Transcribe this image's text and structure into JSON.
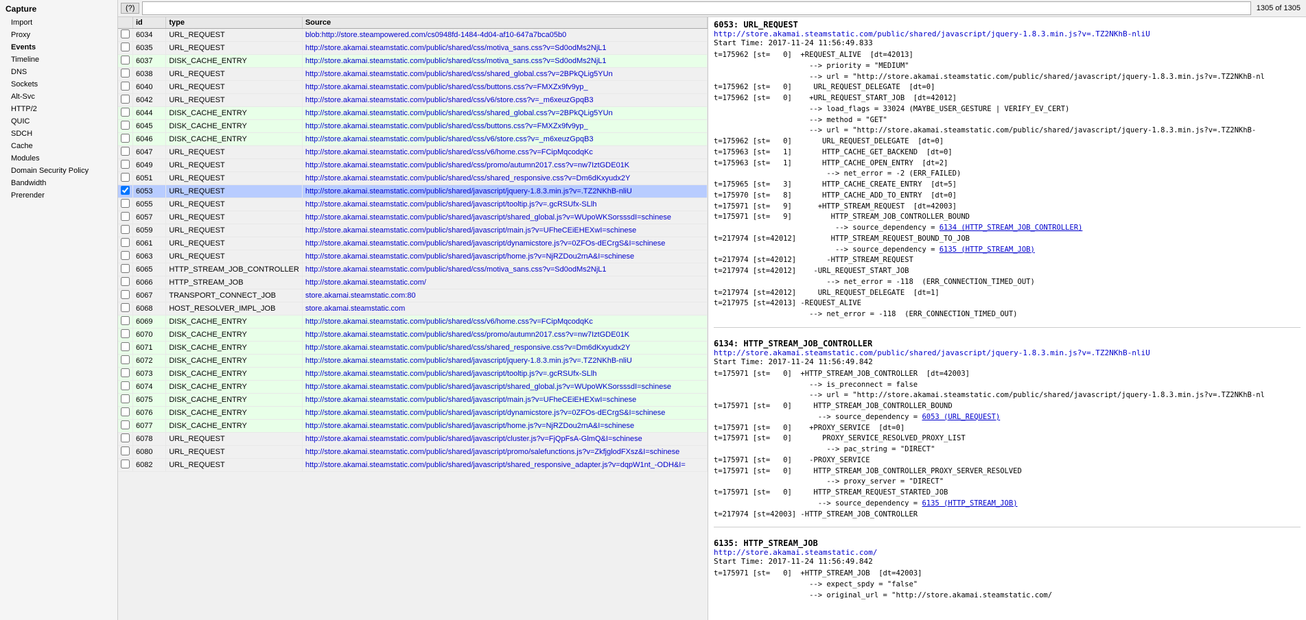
{
  "sidebar": {
    "capture_label": "Capture",
    "items": [
      {
        "id": "import",
        "label": "Import",
        "active": false
      },
      {
        "id": "proxy",
        "label": "Proxy",
        "active": false
      },
      {
        "id": "events",
        "label": "Events",
        "active": false,
        "bold": true
      },
      {
        "id": "timeline",
        "label": "Timeline",
        "active": false
      },
      {
        "id": "dns",
        "label": "DNS",
        "active": false
      },
      {
        "id": "sockets",
        "label": "Sockets",
        "active": false
      },
      {
        "id": "alt-svc",
        "label": "Alt-Svc",
        "active": false
      },
      {
        "id": "http2",
        "label": "HTTP/2",
        "active": false
      },
      {
        "id": "quic",
        "label": "QUIC",
        "active": false
      },
      {
        "id": "sdch",
        "label": "SDCH",
        "active": false
      },
      {
        "id": "cache",
        "label": "Cache",
        "active": false
      },
      {
        "id": "modules",
        "label": "Modules",
        "active": false
      },
      {
        "id": "domain-security-policy",
        "label": "Domain Security Policy",
        "active": false
      },
      {
        "id": "bandwidth",
        "label": "Bandwidth",
        "active": false
      },
      {
        "id": "prerender",
        "label": "Prerender",
        "active": false
      }
    ]
  },
  "toolbar": {
    "help_label": "(?)",
    "search_placeholder": "",
    "count_label": "1305 of 1305"
  },
  "table": {
    "columns": [
      "",
      "id",
      "type",
      "source"
    ],
    "source_header": "Source",
    "rows": [
      {
        "id": "6034",
        "type": "URL_REQUEST",
        "source": "blob:http://store.steampowered.com/cs0948fd-1484-4d04-af10-647a7bca05b0",
        "checked": false,
        "rowtype": "normal",
        "selected": false
      },
      {
        "id": "6035",
        "type": "URL_REQUEST",
        "source": "http://store.akamai.steamstatic.com/public/shared/css/motiva_sans.css?v=Sd0odMs2NjL1",
        "checked": false,
        "rowtype": "normal",
        "selected": false
      },
      {
        "id": "6037",
        "type": "DISK_CACHE_ENTRY",
        "source": "http://store.akamai.steamstatic.com/public/shared/css/motiva_sans.css?v=Sd0odMs2NjL1",
        "checked": false,
        "rowtype": "disk-cache",
        "selected": false
      },
      {
        "id": "6038",
        "type": "URL_REQUEST",
        "source": "http://store.akamai.steamstatic.com/public/shared/css/shared_global.css?v=2BPkQLig5YUn",
        "checked": false,
        "rowtype": "normal",
        "selected": false
      },
      {
        "id": "6040",
        "type": "URL_REQUEST",
        "source": "http://store.akamai.steamstatic.com/public/shared/css/buttons.css?v=FMXZx9fv9yp_",
        "checked": false,
        "rowtype": "normal",
        "selected": false
      },
      {
        "id": "6042",
        "type": "URL_REQUEST",
        "source": "http://store.akamai.steamstatic.com/public/shared/css/v6/store.css?v=_m6xeuzGpqB3",
        "checked": false,
        "rowtype": "normal",
        "selected": false
      },
      {
        "id": "6044",
        "type": "DISK_CACHE_ENTRY",
        "source": "http://store.akamai.steamstatic.com/public/shared/css/shared_global.css?v=2BPkQLig5YUn",
        "checked": false,
        "rowtype": "disk-cache",
        "selected": false
      },
      {
        "id": "6045",
        "type": "DISK_CACHE_ENTRY",
        "source": "http://store.akamai.steamstatic.com/public/shared/css/buttons.css?v=FMXZx9fv9yp_",
        "checked": false,
        "rowtype": "disk-cache",
        "selected": false
      },
      {
        "id": "6046",
        "type": "DISK_CACHE_ENTRY",
        "source": "http://store.akamai.steamstatic.com/public/shared/css/v6/store.css?v=_m6xeuzGpqB3",
        "checked": false,
        "rowtype": "disk-cache",
        "selected": false
      },
      {
        "id": "6047",
        "type": "URL_REQUEST",
        "source": "http://store.akamai.steamstatic.com/public/shared/css/v6/home.css?v=FCipMqcodqKc",
        "checked": false,
        "rowtype": "normal",
        "selected": false
      },
      {
        "id": "6049",
        "type": "URL_REQUEST",
        "source": "http://store.akamai.steamstatic.com/public/shared/css/promo/autumn2017.css?v=nw7IztGDE01K",
        "checked": false,
        "rowtype": "normal",
        "selected": false
      },
      {
        "id": "6051",
        "type": "URL_REQUEST",
        "source": "http://store.akamai.steamstatic.com/public/shared/css/shared_responsive.css?v=Dm6dKxyudx2Y",
        "checked": false,
        "rowtype": "normal",
        "selected": false
      },
      {
        "id": "6053",
        "type": "URL_REQUEST",
        "source": "http://store.akamai.steamstatic.com/public/shared/javascript/jquery-1.8.3.min.js?v=.TZ2NKhB-nliU",
        "checked": true,
        "rowtype": "normal",
        "selected": true
      },
      {
        "id": "6055",
        "type": "URL_REQUEST",
        "source": "http://store.akamai.steamstatic.com/public/shared/javascript/tooltip.js?v=.gcRSUfx-SLlh",
        "checked": false,
        "rowtype": "normal",
        "selected": false
      },
      {
        "id": "6057",
        "type": "URL_REQUEST",
        "source": "http://store.akamai.steamstatic.com/public/shared/javascript/shared_global.js?v=WUpoWKSorsssdI=schinese",
        "checked": false,
        "rowtype": "normal",
        "selected": false
      },
      {
        "id": "6059",
        "type": "URL_REQUEST",
        "source": "http://store.akamai.steamstatic.com/public/shared/javascript/main.js?v=UFheCEiEHEXwI=schinese",
        "checked": false,
        "rowtype": "normal",
        "selected": false
      },
      {
        "id": "6061",
        "type": "URL_REQUEST",
        "source": "http://store.akamai.steamstatic.com/public/shared/javascript/dynamicstore.js?v=0ZFOs-dECrgS&I=schinese",
        "checked": false,
        "rowtype": "normal",
        "selected": false
      },
      {
        "id": "6063",
        "type": "URL_REQUEST",
        "source": "http://store.akamai.steamstatic.com/public/shared/javascript/home.js?v=NjRZDou2rnA&I=schinese",
        "checked": false,
        "rowtype": "normal",
        "selected": false
      },
      {
        "id": "6065",
        "type": "HTTP_STREAM_JOB_CONTROLLER",
        "source": "http://store.akamai.steamstatic.com/public/shared/css/motiva_sans.css?v=Sd0odMs2NjL1",
        "checked": false,
        "rowtype": "normal",
        "selected": false
      },
      {
        "id": "6066",
        "type": "HTTP_STREAM_JOB",
        "source": "http://store.akamai.steamstatic.com/",
        "checked": false,
        "rowtype": "normal",
        "selected": false
      },
      {
        "id": "6067",
        "type": "TRANSPORT_CONNECT_JOB",
        "source": "store.akamai.steamstatic.com:80",
        "checked": false,
        "rowtype": "normal",
        "selected": false
      },
      {
        "id": "6068",
        "type": "HOST_RESOLVER_IMPL_JOB",
        "source": "store.akamai.steamstatic.com",
        "checked": false,
        "rowtype": "normal",
        "selected": false
      },
      {
        "id": "6069",
        "type": "DISK_CACHE_ENTRY",
        "source": "http://store.akamai.steamstatic.com/public/shared/css/v6/home.css?v=FCipMqcodqKc",
        "checked": false,
        "rowtype": "disk-cache",
        "selected": false
      },
      {
        "id": "6070",
        "type": "DISK_CACHE_ENTRY",
        "source": "http://store.akamai.steamstatic.com/public/shared/css/promo/autumn2017.css?v=nw7IztGDE01K",
        "checked": false,
        "rowtype": "disk-cache",
        "selected": false
      },
      {
        "id": "6071",
        "type": "DISK_CACHE_ENTRY",
        "source": "http://store.akamai.steamstatic.com/public/shared/css/shared_responsive.css?v=Dm6dKxyudx2Y",
        "checked": false,
        "rowtype": "disk-cache",
        "selected": false
      },
      {
        "id": "6072",
        "type": "DISK_CACHE_ENTRY",
        "source": "http://store.akamai.steamstatic.com/public/shared/javascript/jquery-1.8.3.min.js?v=.TZ2NKhB-nliU",
        "checked": false,
        "rowtype": "disk-cache",
        "selected": false
      },
      {
        "id": "6073",
        "type": "DISK_CACHE_ENTRY",
        "source": "http://store.akamai.steamstatic.com/public/shared/javascript/tooltip.js?v=.gcRSUfx-SLlh",
        "checked": false,
        "rowtype": "disk-cache",
        "selected": false
      },
      {
        "id": "6074",
        "type": "DISK_CACHE_ENTRY",
        "source": "http://store.akamai.steamstatic.com/public/shared/javascript/shared_global.js?v=WUpoWKSorsssdI=schinese",
        "checked": false,
        "rowtype": "disk-cache",
        "selected": false
      },
      {
        "id": "6075",
        "type": "DISK_CACHE_ENTRY",
        "source": "http://store.akamai.steamstatic.com/public/shared/javascript/main.js?v=UFheCEiEHEXwI=schinese",
        "checked": false,
        "rowtype": "disk-cache",
        "selected": false
      },
      {
        "id": "6076",
        "type": "DISK_CACHE_ENTRY",
        "source": "http://store.akamai.steamstatic.com/public/shared/javascript/dynamicstore.js?v=0ZFOs-dECrgS&I=schinese",
        "checked": false,
        "rowtype": "disk-cache",
        "selected": false
      },
      {
        "id": "6077",
        "type": "DISK_CACHE_ENTRY",
        "source": "http://store.akamai.steamstatic.com/public/shared/javascript/home.js?v=NjRZDou2rnA&I=schinese",
        "checked": false,
        "rowtype": "disk-cache",
        "selected": false
      },
      {
        "id": "6078",
        "type": "URL_REQUEST",
        "source": "http://store.akamai.steamstatic.com/public/shared/javascript/cluster.js?v=FjQpFsA-GlmQ&I=schinese",
        "checked": false,
        "rowtype": "normal",
        "selected": false
      },
      {
        "id": "6080",
        "type": "URL_REQUEST",
        "source": "http://store.akamai.steamstatic.com/public/shared/javascript/promo/salefunctions.js?v=ZkfjglodFXsz&I=schinese",
        "checked": false,
        "rowtype": "normal",
        "selected": false
      },
      {
        "id": "6082",
        "type": "URL_REQUEST",
        "source": "http://store.akamai.steamstatic.com/public/shared/javascript/shared_responsive_adapter.js?v=dqpW1nt_-ODH&I=",
        "checked": false,
        "rowtype": "normal",
        "selected": false
      }
    ]
  },
  "detail": {
    "sections": [
      {
        "id": "6053",
        "title": "6053: URL_REQUEST",
        "url": "http://store.akamai.steamstatic.com/public/shared/javascript/jquery-1.8.3.min.js?v=.TZ2NKhB-nliU",
        "start_time": "Start Time: 2017-11-24 11:56:49.833",
        "log": "t=175962 [st=   0]  +REQUEST_ALIVE  [dt=42013]\n                      --> priority = \"MEDIUM\"\n                      --> url = \"http://store.akamai.steamstatic.com/public/shared/javascript/jquery-1.8.3.min.js?v=.TZ2NKhB-nl\nt=175962 [st=   0]     URL_REQUEST_DELEGATE  [dt=0]\nt=175962 [st=   0]    +URL_REQUEST_START_JOB  [dt=42012]\n                      --> load_flags = 33024 (MAYBE_USER_GESTURE | VERIFY_EV_CERT)\n                      --> method = \"GET\"\n                      --> url = \"http://store.akamai.steamstatic.com/public/shared/javascript/jquery-1.8.3.min.js?v=.TZ2NKhB-\nt=175962 [st=   0]       URL_REQUEST_DELEGATE  [dt=0]\nt=175963 [st=   1]       HTTP_CACHE_GET_BACKEND  [dt=0]\nt=175963 [st=   1]       HTTP_CACHE_OPEN_ENTRY  [dt=2]\n                          --> net_error = -2 (ERR_FAILED)\nt=175965 [st=   3]       HTTP_CACHE_CREATE_ENTRY  [dt=5]\nt=175970 [st=   8]       HTTP_CACHE_ADD_TO_ENTRY  [dt=0]\nt=175971 [st=   9]      +HTTP_STREAM_REQUEST  [dt=42003]\nt=175971 [st=   9]         HTTP_STREAM_JOB_CONTROLLER_BOUND\n                            --> source_dependency = 6134 (HTTP_STREAM_JOB_CONTROLLER)\nt=217974 [st=42012]        HTTP_STREAM_REQUEST_BOUND_TO_JOB\n                            --> source_dependency = 6135 (HTTP_STREAM_JOB)\nt=217974 [st=42012]       -HTTP_STREAM_REQUEST\nt=217974 [st=42012]    -URL_REQUEST_START_JOB\n                          --> net_error = -118  (ERR_CONNECTION_TIMED_OUT)\nt=217974 [st=42012]     URL_REQUEST_DELEGATE  [dt=1]\nt=217975 [st=42013] -REQUEST_ALIVE\n                      --> net_error = -118  (ERR_CONNECTION_TIMED_OUT)"
      },
      {
        "id": "6134",
        "title": "6134: HTTP_STREAM_JOB_CONTROLLER",
        "url": "http://store.akamai.steamstatic.com/public/shared/javascript/jquery-1.8.3.min.js?v=.TZ2NKhB-nliU",
        "start_time": "Start Time: 2017-11-24 11:56:49.842",
        "log": "t=175971 [st=   0]  +HTTP_STREAM_JOB_CONTROLLER  [dt=42003]\n                      --> is_preconnect = false\n                      --> url = \"http://store.akamai.steamstatic.com/public/shared/javascript/jquery-1.8.3.min.js?v=.TZ2NKhB-nl\nt=175971 [st=   0]     HTTP_STREAM_JOB_CONTROLLER_BOUND\n                        --> source_dependency = 6053 (URL_REQUEST)\nt=175971 [st=   0]    +PROXY_SERVICE  [dt=0]\nt=175971 [st=   0]       PROXY_SERVICE_RESOLVED_PROXY_LIST\n                          --> pac_string = \"DIRECT\"\nt=175971 [st=   0]    -PROXY_SERVICE\nt=175971 [st=   0]     HTTP_STREAM_JOB_CONTROLLER_PROXY_SERVER_RESOLVED\n                          --> proxy_server = \"DIRECT\"\nt=175971 [st=   0]     HTTP_STREAM_REQUEST_STARTED_JOB\n                        --> source_dependency = 6135 (HTTP_STREAM_JOB)\nt=217974 [st=42003] -HTTP_STREAM_JOB_CONTROLLER"
      },
      {
        "id": "6135",
        "title": "6135: HTTP_STREAM_JOB",
        "url": "http://store.akamai.steamstatic.com/",
        "start_time": "Start Time: 2017-11-24 11:56:49.842",
        "log": "t=175971 [st=   0]  +HTTP_STREAM_JOB  [dt=42003]\n                      --> expect_spdy = \"false\"\n                      --> original_url = \"http://store.akamai.steamstatic.com/"
      }
    ]
  },
  "colors": {
    "selected_row": "#b8ccff",
    "disk_cache_row": "#e8ffe8",
    "link_color": "#0000cc"
  }
}
